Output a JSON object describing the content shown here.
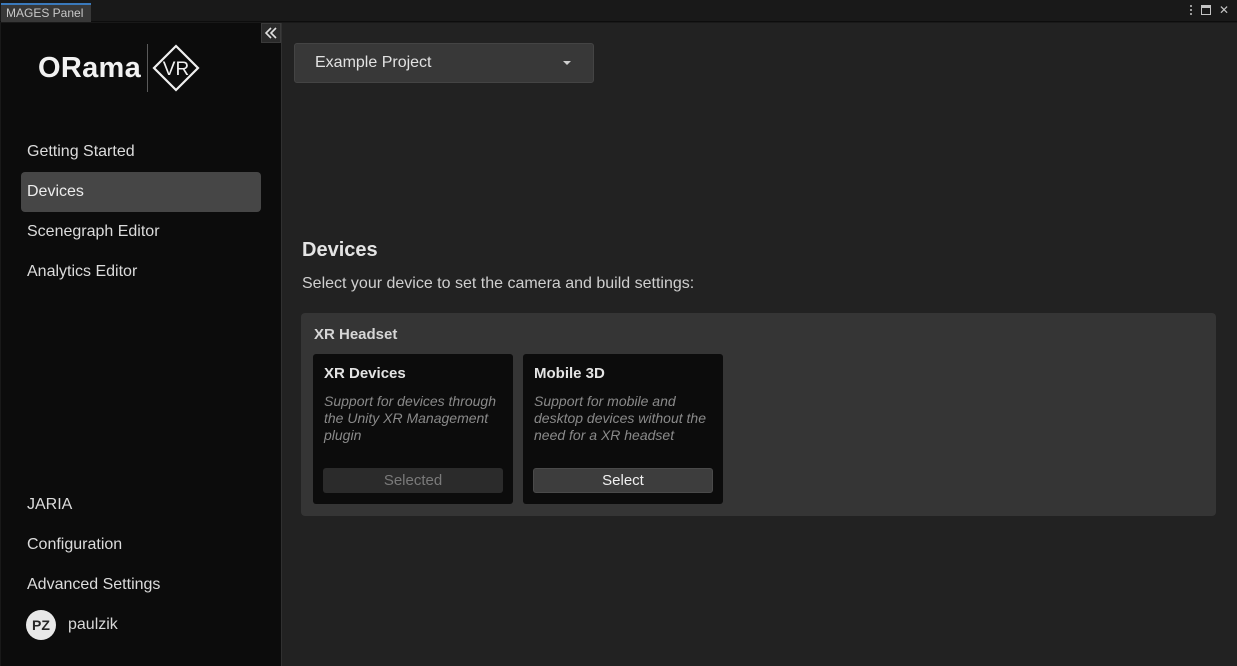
{
  "window": {
    "tab_title": "MAGES Panel"
  },
  "sidebar": {
    "logo_text": "ORama",
    "logo_badge": "VR",
    "nav_top": [
      {
        "label": "Getting Started",
        "active": false
      },
      {
        "label": "Devices",
        "active": true
      },
      {
        "label": "Scenegraph Editor",
        "active": false
      },
      {
        "label": "Analytics Editor",
        "active": false
      }
    ],
    "nav_bottom": [
      {
        "label": "JARIA"
      },
      {
        "label": "Configuration"
      },
      {
        "label": "Advanced Settings"
      }
    ],
    "user": {
      "initials": "PZ",
      "name": "paulzik"
    }
  },
  "main": {
    "project_selected": "Example Project",
    "section_title": "Devices",
    "section_desc": "Select your device to set the camera and build settings:",
    "group_label": "XR Headset",
    "cards": [
      {
        "title": "XR Devices",
        "description": "Support for devices through the Unity XR Management plugin",
        "button": "Selected",
        "state": "selected"
      },
      {
        "title": "Mobile 3D",
        "description": "Support for mobile and desktop devices without the need for a XR headset",
        "button": "Select",
        "state": "available"
      }
    ]
  },
  "icons": {
    "collapse": "double-chevron-left-icon",
    "menu": "kebab-menu-icon",
    "maximize": "maximize-icon",
    "close": "close-icon",
    "dropdown": "caret-down-icon"
  },
  "colors": {
    "tab_accent": "#3a79bb",
    "sidebar_bg": "#0c0c0c",
    "main_bg": "#222222",
    "active_nav": "#464646"
  }
}
